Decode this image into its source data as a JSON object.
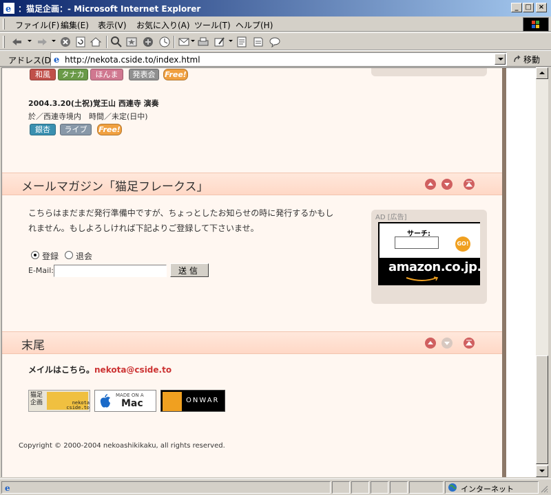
{
  "window": {
    "title": "：猫足企画：- Microsoft Internet Explorer",
    "minimize": "_",
    "maximize": "□",
    "close": "×"
  },
  "menu": [
    "ファイル(F)",
    "編集(E)",
    "表示(V)",
    "お気に入り(A)",
    "ツール(T)",
    "ヘルプ(H)"
  ],
  "address": {
    "label": "アドレス(D)",
    "url": "http://nekota.cside.to/index.html",
    "go_label": "移動"
  },
  "page": {
    "event_tags_top": [
      "和風",
      "タナカ",
      "ほんま",
      "発表会",
      "Free!"
    ],
    "event_title": "2004.3.20(土祝)覚王山 西連寺 演奏",
    "event_detail": "於／西連寺境内　時間／未定(日中)",
    "event_tags": [
      "銀杏",
      "ライブ",
      "Free!"
    ],
    "mailmag": {
      "title": "メールマガジン「猫足フレークス」",
      "body_line1": "こちらはまだまだ発行準備中ですが、ちょっとしたお知らせの時に発行するかもし",
      "body_line2": "れません。もしよろしければ下記よりご登録して下さいませ。",
      "radio_subscribe": "登録",
      "radio_unsubscribe": "退会",
      "email_label": "E-Mail:",
      "submit": "送信"
    },
    "ad": {
      "label": "AD [広告]",
      "search_label": "サーチ:",
      "go": "GO!",
      "brand": "amazon.co.jp."
    },
    "footer": {
      "title": "末尾",
      "mail_prefix": "メイルはこちら。",
      "mail_address": "nekota@cside.to",
      "badge_site_line1": "猫足",
      "badge_site_line2": "企画",
      "badge_site_domain": "nekota cside.to",
      "badge_mac_line1": "MADE ON A",
      "badge_mac_line2": "Mac",
      "badge_onwar": "ONWAR",
      "copyright": "Copyright © 2000-2004 nekoashikikaku, all rights reserved."
    }
  },
  "status": {
    "zone": "インターネット"
  },
  "colors": {
    "tag_wafuu": "#c0504a",
    "tag_tanaka": "#6a9a48",
    "tag_honma": "#d07890",
    "tag_happyo": "#909090",
    "tag_free": "#f0a040",
    "tag_ginnan": "#3a90b0",
    "tag_live": "#8898a8",
    "mail_link": "#cc3333"
  }
}
